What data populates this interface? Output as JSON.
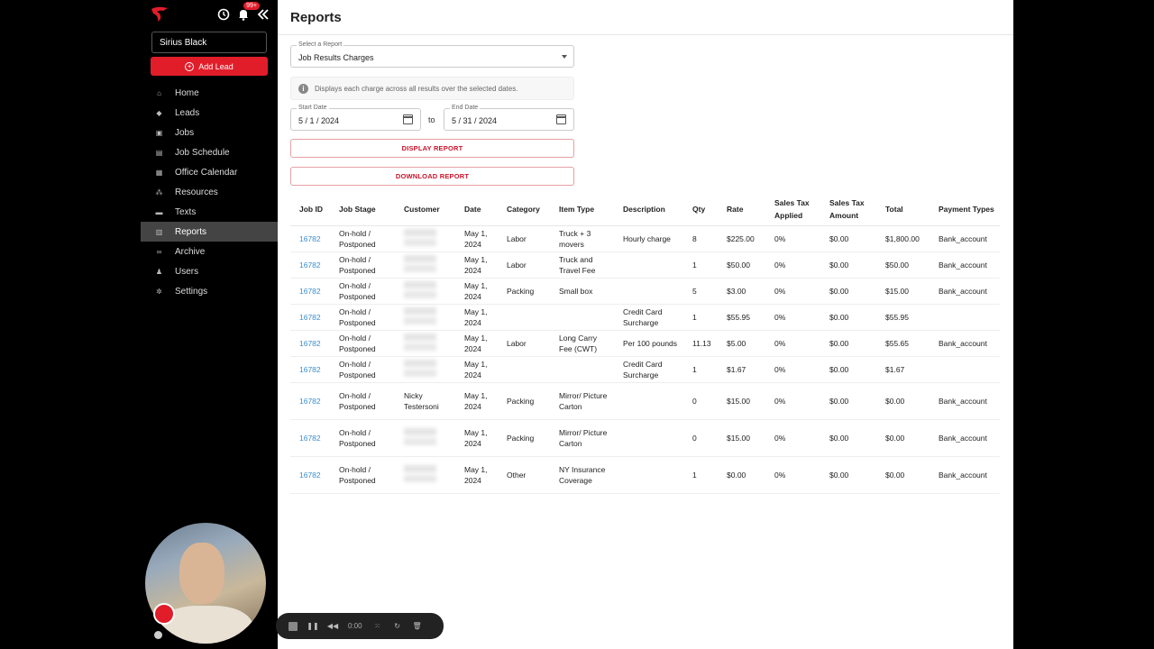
{
  "sidebar": {
    "user": "Sirius Black",
    "add_lead": "Add Lead",
    "notification_badge": "99+",
    "items": [
      {
        "label": "Home",
        "icon": "home-icon"
      },
      {
        "label": "Leads",
        "icon": "tag-icon"
      },
      {
        "label": "Jobs",
        "icon": "truck-icon"
      },
      {
        "label": "Job Schedule",
        "icon": "schedule-icon"
      },
      {
        "label": "Office Calendar",
        "icon": "calendar-icon"
      },
      {
        "label": "Resources",
        "icon": "resources-icon"
      },
      {
        "label": "Texts",
        "icon": "chat-icon"
      },
      {
        "label": "Reports",
        "icon": "reports-icon"
      },
      {
        "label": "Archive",
        "icon": "archive-icon"
      },
      {
        "label": "Users",
        "icon": "users-icon"
      },
      {
        "label": "Settings",
        "icon": "gear-icon"
      }
    ],
    "active": "Reports"
  },
  "header": {
    "title": "Reports"
  },
  "report_form": {
    "select_label": "Select a Report",
    "select_value": "Job Results Charges",
    "info": "Displays each charge across all results over the selected dates.",
    "start_label": "Start Date",
    "start_value": "5 / 1 / 2024",
    "end_label": "End Date",
    "end_value": "5 / 31 / 2024",
    "to": "to",
    "display_btn": "DISPLAY REPORT",
    "download_btn": "DOWNLOAD REPORT"
  },
  "table": {
    "headers": [
      "Job ID",
      "Job Stage",
      "Customer",
      "Date",
      "Category",
      "Item Type",
      "Description",
      "Qty",
      "Rate",
      "Sales Tax Applied",
      "Sales Tax Amount",
      "Total",
      "Payment Types"
    ],
    "rows": [
      {
        "job_id": "16782",
        "stage": "On-hold / Postponed",
        "customer": "",
        "date": "May 1, 2024",
        "category": "Labor",
        "item_type": "Truck + 3 movers",
        "description": "Hourly charge",
        "qty": "8",
        "rate": "$225.00",
        "tax_applied": "0%",
        "tax_amount": "$0.00",
        "total": "$1,800.00",
        "payment": "Bank_account"
      },
      {
        "job_id": "16782",
        "stage": "On-hold / Postponed",
        "customer": "",
        "date": "May 1, 2024",
        "category": "Labor",
        "item_type": "Truck and Travel Fee",
        "description": "",
        "qty": "1",
        "rate": "$50.00",
        "tax_applied": "0%",
        "tax_amount": "$0.00",
        "total": "$50.00",
        "payment": "Bank_account"
      },
      {
        "job_id": "16782",
        "stage": "On-hold / Postponed",
        "customer": "",
        "date": "May 1, 2024",
        "category": "Packing",
        "item_type": "Small box",
        "description": "",
        "qty": "5",
        "rate": "$3.00",
        "tax_applied": "0%",
        "tax_amount": "$0.00",
        "total": "$15.00",
        "payment": "Bank_account"
      },
      {
        "job_id": "16782",
        "stage": "On-hold / Postponed",
        "customer": "",
        "date": "May 1, 2024",
        "category": "",
        "item_type": "",
        "description": "Credit Card Surcharge",
        "qty": "1",
        "rate": "$55.95",
        "tax_applied": "0%",
        "tax_amount": "$0.00",
        "total": "$55.95",
        "payment": ""
      },
      {
        "job_id": "16782",
        "stage": "On-hold / Postponed",
        "customer": "",
        "date": "May 1, 2024",
        "category": "Labor",
        "item_type": "Long Carry Fee (CWT)",
        "description": "Per 100 pounds",
        "qty": "11.13",
        "rate": "$5.00",
        "tax_applied": "0%",
        "tax_amount": "$0.00",
        "total": "$55.65",
        "payment": "Bank_account"
      },
      {
        "job_id": "16782",
        "stage": "On-hold / Postponed",
        "customer": "",
        "date": "May 1, 2024",
        "category": "",
        "item_type": "",
        "description": "Credit Card Surcharge",
        "qty": "1",
        "rate": "$1.67",
        "tax_applied": "0%",
        "tax_amount": "$0.00",
        "total": "$1.67",
        "payment": ""
      },
      {
        "job_id": "16782",
        "stage": "On-hold / Postponed",
        "customer": "Nicky Testersoni",
        "date": "May 1, 2024",
        "category": "Packing",
        "item_type": "Mirror/ Picture Carton",
        "description": "",
        "qty": "0",
        "rate": "$15.00",
        "tax_applied": "0%",
        "tax_amount": "$0.00",
        "total": "$0.00",
        "payment": "Bank_account"
      },
      {
        "job_id": "16782",
        "stage": "On-hold / Postponed",
        "customer": "",
        "date": "May 1, 2024",
        "category": "Packing",
        "item_type": "Mirror/ Picture Carton",
        "description": "",
        "qty": "0",
        "rate": "$15.00",
        "tax_applied": "0%",
        "tax_amount": "$0.00",
        "total": "$0.00",
        "payment": "Bank_account"
      },
      {
        "job_id": "16782",
        "stage": "On-hold / Postponed",
        "customer": "",
        "date": "May 1, 2024",
        "category": "Other",
        "item_type": "NY Insurance Coverage",
        "description": "",
        "qty": "1",
        "rate": "$0.00",
        "tax_applied": "0%",
        "tax_amount": "$0.00",
        "total": "$0.00",
        "payment": "Bank_account"
      }
    ]
  },
  "player": {
    "time": "0:00"
  },
  "colors": {
    "accent": "#e11d2a",
    "link": "#3a8fcf",
    "sidebar_bg": "#000000"
  }
}
